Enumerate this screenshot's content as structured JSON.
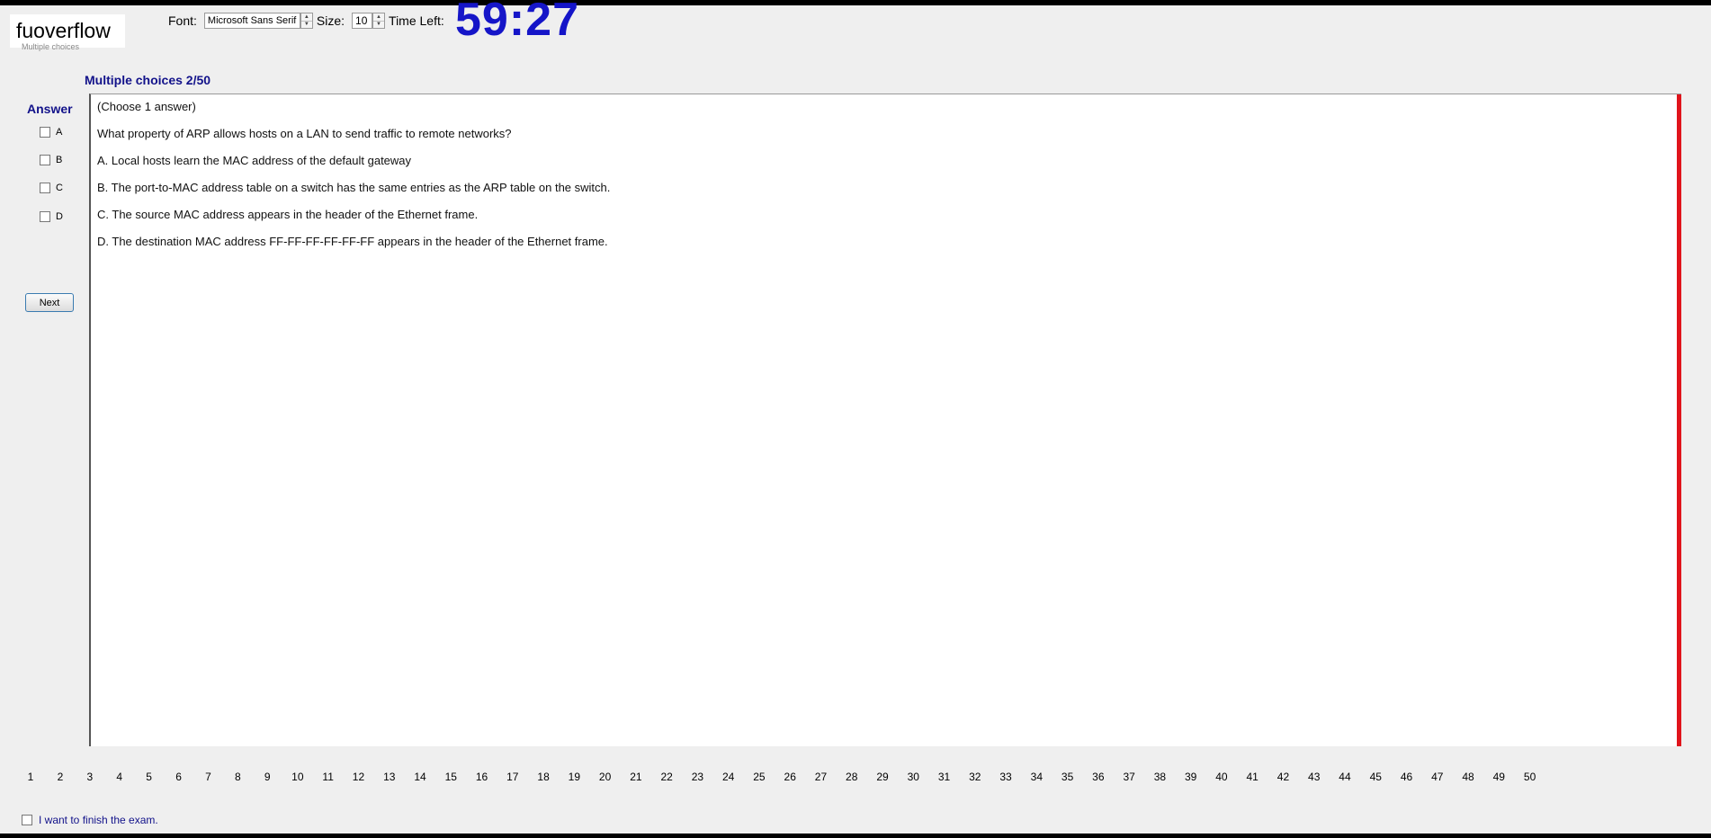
{
  "app": {
    "logo_text": "fuoverflow",
    "faded_label": "Multiple choices"
  },
  "toolbar": {
    "font_label": "Font:",
    "font_value": "Microsoft Sans Serif",
    "size_label": "Size:",
    "size_value": "10",
    "time_label": "Time Left:",
    "time_value": "59:27"
  },
  "section": {
    "title": "Multiple choices 2/50"
  },
  "answer": {
    "title": "Answer",
    "options": [
      "A",
      "B",
      "C",
      "D"
    ],
    "next_label": "Next"
  },
  "question": {
    "instruction": "(Choose 1 answer)",
    "text": "What property of ARP allows hosts on a LAN to send traffic to remote networks?",
    "choices": [
      "A.  Local hosts learn the MAC address of the default gateway",
      "B.  The port-to-MAC address table on a switch has the same entries as the ARP table on the switch.",
      "C.  The source MAC address appears in the header of the Ethernet frame.",
      "D.  The destination MAC address FF-FF-FF-FF-FF-FF appears in the header of the Ethernet frame."
    ]
  },
  "pager": {
    "pages": [
      "1",
      "2",
      "3",
      "4",
      "5",
      "6",
      "7",
      "8",
      "9",
      "10",
      "11",
      "12",
      "13",
      "14",
      "15",
      "16",
      "17",
      "18",
      "19",
      "20",
      "21",
      "22",
      "23",
      "24",
      "25",
      "26",
      "27",
      "28",
      "29",
      "30",
      "31",
      "32",
      "33",
      "34",
      "35",
      "36",
      "37",
      "38",
      "39",
      "40",
      "41",
      "42",
      "43",
      "44",
      "45",
      "46",
      "47",
      "48",
      "49",
      "50"
    ]
  },
  "finish": {
    "label": "I want to finish the exam."
  },
  "colors": {
    "accent": "#1515c8",
    "label_navy": "#12128a",
    "rail": "#e0141c"
  }
}
